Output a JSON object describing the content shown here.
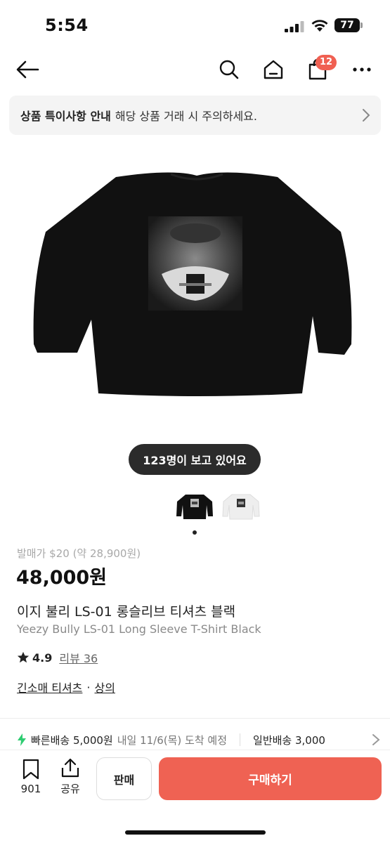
{
  "status_bar": {
    "time": "5:54",
    "battery": "77"
  },
  "nav": {
    "icons": [
      "back-arrow-icon",
      "search-icon",
      "home-icon",
      "shopping-bag-icon",
      "more-icon"
    ],
    "cart_count": "12"
  },
  "notice": {
    "title": "상품 특이사항 안내",
    "text": "해당 상품 거래 시 주의하세요."
  },
  "product": {
    "viewers": "123명이 보고 있어요",
    "release_price": "발매가 $20 (약 28,900원)",
    "price": "48,000원",
    "name_ko": "이지 불리 LS-01 롱슬리브 티셔츠 블랙",
    "name_en": "Yeezy Bully LS-01 Long Sleeve T-Shirt Black",
    "rating": "4.9",
    "review": "리뷰 36",
    "categories": [
      "긴소매 티셔츠",
      "상의"
    ],
    "category_separator": "·"
  },
  "shipping": {
    "fast": "빠른배송 5,000원",
    "fast_date": "내일 11/6(목) 도착 예정",
    "normal": "일반배송 3,000"
  },
  "bottom_bar": {
    "wish_count": "901",
    "share_label": "공유",
    "sell_label": "판매",
    "buy_label": "구매하기"
  },
  "colors": {
    "accent": "#ef6253",
    "badge": "#f06052"
  }
}
